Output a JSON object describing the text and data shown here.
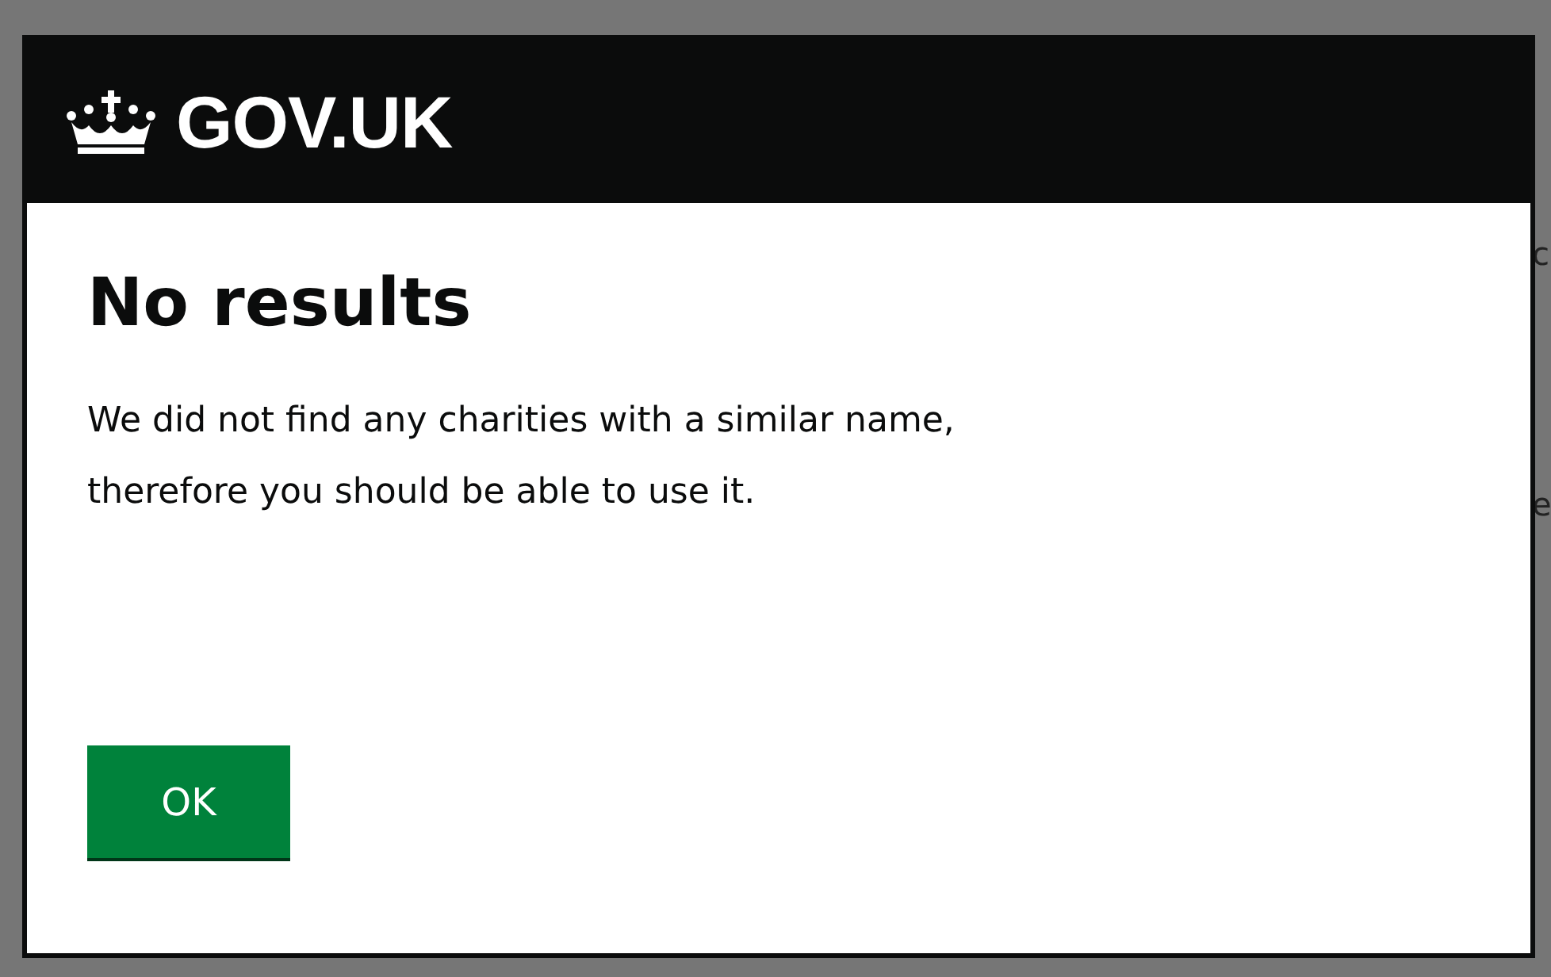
{
  "background_page": {
    "fragments": [
      "c",
      "e"
    ]
  },
  "dialog": {
    "brand": "GOV.UK",
    "title": "No results",
    "message": "We did not find any charities with a similar name, therefore you should be able to use it.",
    "buttons": [
      "OK"
    ]
  }
}
